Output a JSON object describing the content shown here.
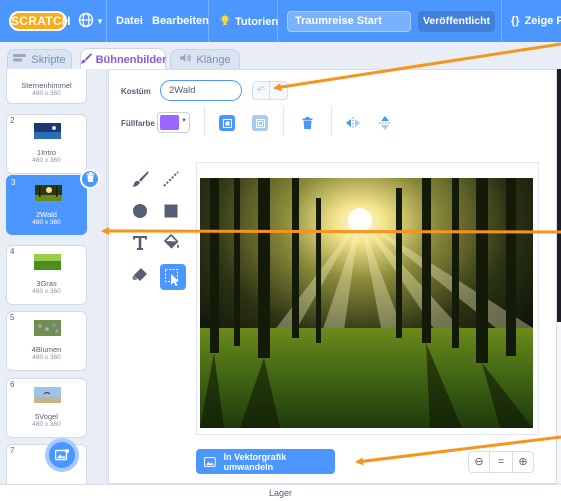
{
  "menubar": {
    "logo": "SCRATCH",
    "menu": [
      "Datei",
      "Bearbeiten",
      "Tutorien"
    ],
    "project_title": "Traumreise Start",
    "publish": "Veröffentlicht",
    "see_project": "Zeige Pr"
  },
  "tabs": [
    "Skripte",
    "Bühnenbilder",
    "Klänge"
  ],
  "costumes": [
    {
      "num": "",
      "name": "Sternenhimmel",
      "dims": "480 x 360"
    },
    {
      "num": "2",
      "name": "1Intro",
      "dims": "480 x 360"
    },
    {
      "num": "3",
      "name": "2Wald",
      "dims": "480 x 360",
      "selected": true
    },
    {
      "num": "4",
      "name": "3Gras",
      "dims": "480 x 360"
    },
    {
      "num": "5",
      "name": "4Blumen",
      "dims": "480 x 360"
    },
    {
      "num": "6",
      "name": "5Vogel",
      "dims": "480 x 360"
    },
    {
      "num": "7",
      "name": "",
      "dims": ""
    }
  ],
  "editor": {
    "costume_label": "Kostüm",
    "costume_name": "2Wald",
    "fill_label": "Füllfarbe",
    "fill_color": "#9966ff",
    "convert_button": "In Vektorgrafik umwandeln",
    "zoom": [
      "−",
      "=",
      "+"
    ]
  },
  "icons": [
    "globe-icon",
    "lightbulb-icon",
    "code-icon",
    "undo-icon",
    "redo-icon",
    "group-icon",
    "ungroup-icon",
    "delete-icon",
    "flip-horizontal-icon",
    "flip-vertical-icon",
    "brush-icon",
    "line-icon",
    "circle-icon",
    "rectangle-icon",
    "text-icon",
    "fill-icon",
    "eraser-icon",
    "select-icon",
    "image-icon",
    "add-costume-icon"
  ],
  "accent_color": "#4c97ff",
  "annotation_color": "#f7941d",
  "footer": {
    "layer": "Lager"
  }
}
